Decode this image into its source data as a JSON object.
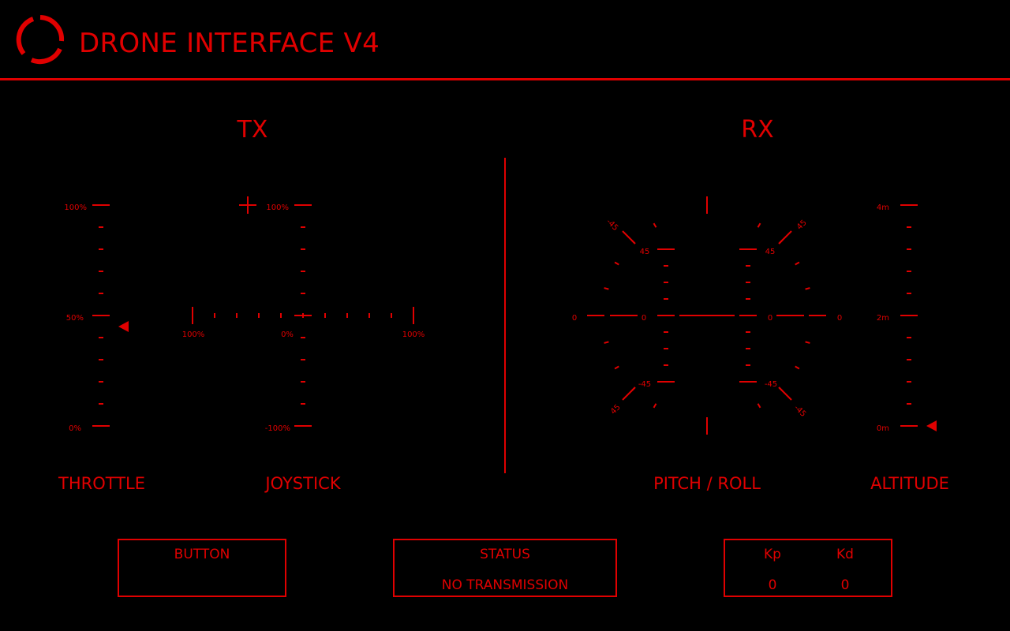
{
  "app": {
    "title": "DRONE INTERFACE V4"
  },
  "tx": {
    "title": "TX",
    "throttle": {
      "label": "THROTTLE",
      "ticks": {
        "top": "100%",
        "mid": "50%",
        "bottom": "0%"
      },
      "value_percent": 45
    },
    "joystick": {
      "label": "JOYSTICK",
      "vertical_ticks": {
        "top": "100%",
        "bottom": "-100%"
      },
      "horizontal_ticks": {
        "left": "100%",
        "center": "0%",
        "right": "100%"
      },
      "cursor_x_percent": -50,
      "cursor_y_percent": 100
    }
  },
  "rx": {
    "title": "RX",
    "pitch_roll": {
      "label": "PITCH / ROLL",
      "outer_labels": {
        "left": "0",
        "right": "0",
        "top_left": "-45",
        "top_right": "45",
        "bottom_left": "45",
        "bottom_right": "-45"
      },
      "inner_labels": {
        "upper": "45",
        "center": "0",
        "lower": "-45"
      }
    },
    "altitude": {
      "label": "ALTITUDE",
      "ticks": {
        "top": "4m",
        "mid": "2m",
        "bottom": "0m"
      },
      "value_m": 0
    }
  },
  "panels": {
    "button": {
      "title": "BUTTON"
    },
    "status": {
      "title": "STATUS",
      "value": "NO TRANSMISSION"
    },
    "gains": {
      "kp_label": "Kp",
      "kd_label": "Kd",
      "kp_value": "0",
      "kd_value": "0"
    }
  },
  "colors": {
    "accent": "#e00000",
    "background": "#000000"
  }
}
